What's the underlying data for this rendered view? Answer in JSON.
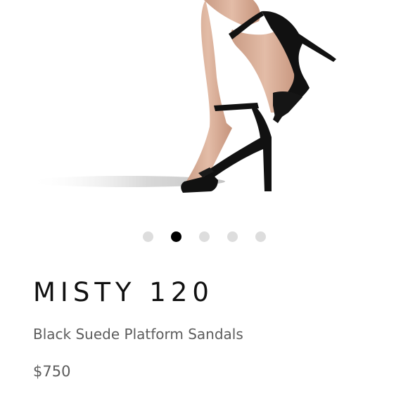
{
  "product": {
    "name": "MISTY 120",
    "subtitle": "Black Suede Platform Sandals",
    "price": "$750"
  },
  "carousel": {
    "total_slides": 5,
    "active_index": 1
  },
  "colors": {
    "dot_active": "#000000",
    "dot_inactive": "#dddddd",
    "title": "#111111",
    "secondary_text": "#5c5c5c"
  }
}
